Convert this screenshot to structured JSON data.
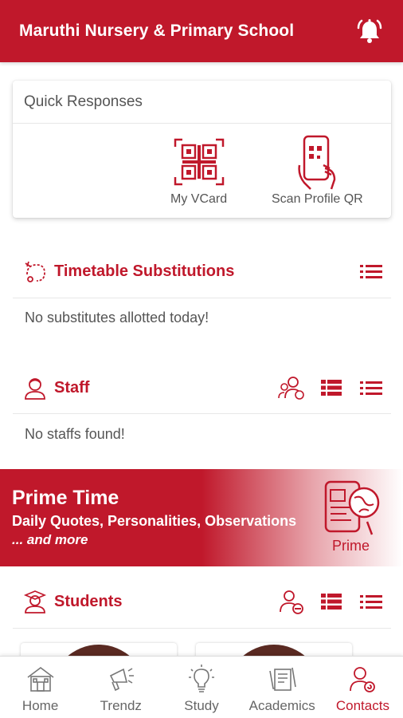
{
  "app": {
    "title": "Maruthi Nursery & Primary School",
    "accent": "#c0182b"
  },
  "quick_responses": {
    "title": "Quick Responses",
    "items": [
      {
        "label": "My VCard",
        "icon": "qr-code-icon"
      },
      {
        "label": "Scan Profile QR",
        "icon": "scan-phone-icon"
      }
    ]
  },
  "timetable": {
    "title": "Timetable Substitutions",
    "empty": "No substitutes allotted today!"
  },
  "staff": {
    "title": "Staff",
    "empty": "No staffs found!"
  },
  "prime": {
    "title": "Prime Time",
    "subtitle": "Daily Quotes, Personalities, Observations",
    "more": "... and more",
    "label": "Prime"
  },
  "students": {
    "title": "Students"
  },
  "nav": [
    {
      "label": "Home",
      "icon": "home-icon"
    },
    {
      "label": "Trendz",
      "icon": "megaphone-icon"
    },
    {
      "label": "Study",
      "icon": "lightbulb-icon"
    },
    {
      "label": "Academics",
      "icon": "academics-icon"
    },
    {
      "label": "Contacts",
      "icon": "contacts-icon",
      "active": true
    }
  ]
}
